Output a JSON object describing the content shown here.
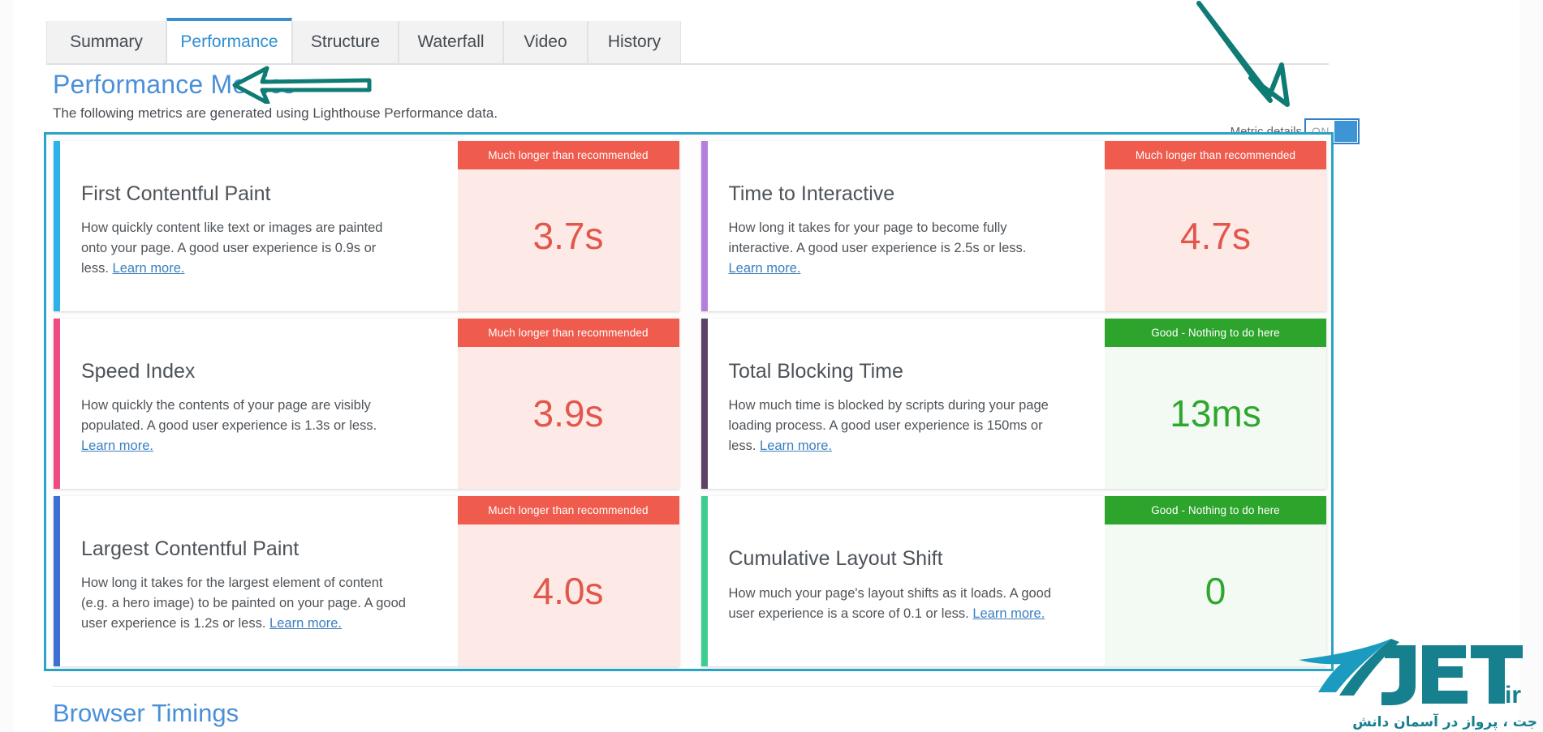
{
  "tabs": [
    {
      "label": "Summary",
      "active": false
    },
    {
      "label": "Performance",
      "active": true
    },
    {
      "label": "Structure",
      "active": false
    },
    {
      "label": "Waterfall",
      "active": false
    },
    {
      "label": "Video",
      "active": false
    },
    {
      "label": "History",
      "active": false
    }
  ],
  "section": {
    "title": "Performance Metrics",
    "subtitle": "The following metrics are generated using Lighthouse Performance data."
  },
  "metric_details": {
    "label": "Metric details",
    "state_text": "ON",
    "enabled": true
  },
  "status_labels": {
    "bad": "Much longer than recommended",
    "good": "Good - Nothing to do here"
  },
  "link_label": "Learn more.",
  "metrics": [
    {
      "name": "First Contentful Paint",
      "description": "How quickly content like text or images are painted onto your page. A good user experience is 0.9s or less.",
      "link": "Learn more.",
      "status": "Much longer than recommended",
      "status_type": "bad",
      "value": "3.7s",
      "accent_color": "#29b3e8"
    },
    {
      "name": "Time to Interactive",
      "description": "How long it takes for your page to become fully interactive. A good user experience is 2.5s or less.",
      "link": "Learn more.",
      "status": "Much longer than recommended",
      "status_type": "bad",
      "value": "4.7s",
      "accent_color": "#b47fdd"
    },
    {
      "name": "Speed Index",
      "description": "How quickly the contents of your page are visibly populated. A good user experience is 1.3s or less.",
      "link": "Learn more.",
      "status": "Much longer than recommended",
      "status_type": "bad",
      "value": "3.9s",
      "accent_color": "#ef4b81"
    },
    {
      "name": "Total Blocking Time",
      "description": "How much time is blocked by scripts during your page loading process. A good user experience is 150ms or less.",
      "link": "Learn more.",
      "status": "Good - Nothing to do here",
      "status_type": "good",
      "value": "13ms",
      "accent_color": "#5d4266"
    },
    {
      "name": "Largest Contentful Paint",
      "description": "How long it takes for the largest element of content (e.g. a hero image) to be painted on your page. A good user experience is 1.2s or less.",
      "link": "Learn more.",
      "status": "Much longer than recommended",
      "status_type": "bad",
      "value": "4.0s",
      "accent_color": "#3b6fd4"
    },
    {
      "name": "Cumulative Layout Shift",
      "description": "How much your page's layout shifts as it loads. A good user experience is a score of 0.1 or less.",
      "link": "Learn more.",
      "status": "Good - Nothing to do here",
      "status_type": "good",
      "value": "0",
      "accent_color": "#3ccd8f"
    }
  ],
  "browser_timings": {
    "title": "Browser Timings"
  },
  "watermark": {
    "brand": "JET",
    "tld": ".ir",
    "tagline": "جت ، پرواز در آسمان دانش"
  },
  "colors": {
    "accent_blue": "#4a90d9",
    "tab_active": "#2f8fd4",
    "bad_badge": "#ef5b4c",
    "bad_value": "#e2574c",
    "bad_bg": "#fdeae7",
    "good_badge": "#2da52d",
    "good_value": "#2fa72f",
    "good_bg": "#f3faf3",
    "annotation": "#0e7b74",
    "highlight_border": "#2aa3c4"
  }
}
